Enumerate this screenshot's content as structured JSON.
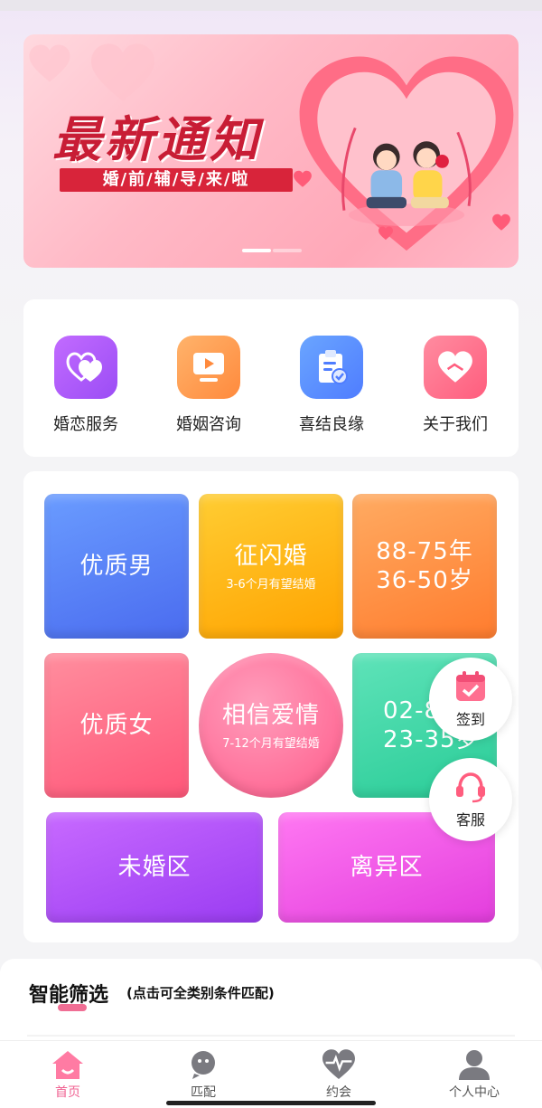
{
  "banner": {
    "title": "最新通知",
    "subtitle": "婚/前/辅/导/来/啦",
    "active_dot": 0,
    "dot_count": 2
  },
  "services": [
    {
      "label": "婚恋服务",
      "icon": "double-heart-icon",
      "color_from": "#c26bff",
      "color_to": "#9b4df5"
    },
    {
      "label": "婚姻咨询",
      "icon": "video-play-icon",
      "color_from": "#ffb36b",
      "color_to": "#ff8a3d"
    },
    {
      "label": "喜结良缘",
      "icon": "clipboard-check-icon",
      "color_from": "#6aa5ff",
      "color_to": "#4f7dff"
    },
    {
      "label": "关于我们",
      "icon": "heart-hands-icon",
      "color_from": "#ff8ca0",
      "color_to": "#ff5d7e"
    }
  ],
  "tiles": {
    "quality_male": {
      "main": "优质男",
      "color_from": "#5d92ff",
      "color_to": "#4a6df0"
    },
    "flash_marriage": {
      "main": "征闪婚",
      "sub": "3-6个月有望结婚",
      "color_from": "#ffc526",
      "color_to": "#ffa400"
    },
    "age_range_1": {
      "line1": "88-75年",
      "line2": "36-50岁",
      "color_from": "#ffa85c",
      "color_to": "#ff7f32"
    },
    "quality_female": {
      "main": "优质女",
      "color_from": "#ff8a9c",
      "color_to": "#ff5d7a"
    },
    "believe_love": {
      "main": "相信爱情",
      "sub": "7-12个月有望结婚",
      "color_from": "#ff8fb0",
      "color_to": "#ff5a8a"
    },
    "age_range_2": {
      "line1": "02-8",
      "line2": "23-35岁",
      "color_from": "#52e0b4",
      "color_to": "#2ccf9a"
    },
    "unmarried": {
      "main": "未婚区",
      "color_from": "#c463ff",
      "color_to": "#9d3df5"
    },
    "divorced": {
      "main": "离异区",
      "color_from": "#ff6cf0",
      "color_to": "#e63ee0"
    }
  },
  "float_buttons": {
    "checkin": {
      "label": "签到",
      "icon": "calendar-check-icon"
    },
    "service": {
      "label": "客服",
      "icon": "headset-icon"
    }
  },
  "filter": {
    "title": "智能筛选",
    "hint": "(点击可全类别条件匹配)"
  },
  "tabbar": [
    {
      "label": "首页",
      "icon": "home-icon",
      "active": true
    },
    {
      "label": "匹配",
      "icon": "match-icon",
      "active": false
    },
    {
      "label": "约会",
      "icon": "heartbeat-icon",
      "active": false
    },
    {
      "label": "个人中心",
      "icon": "user-icon",
      "active": false
    }
  ],
  "colors": {
    "accent": "#f06292",
    "banner_red": "#c81d35"
  }
}
